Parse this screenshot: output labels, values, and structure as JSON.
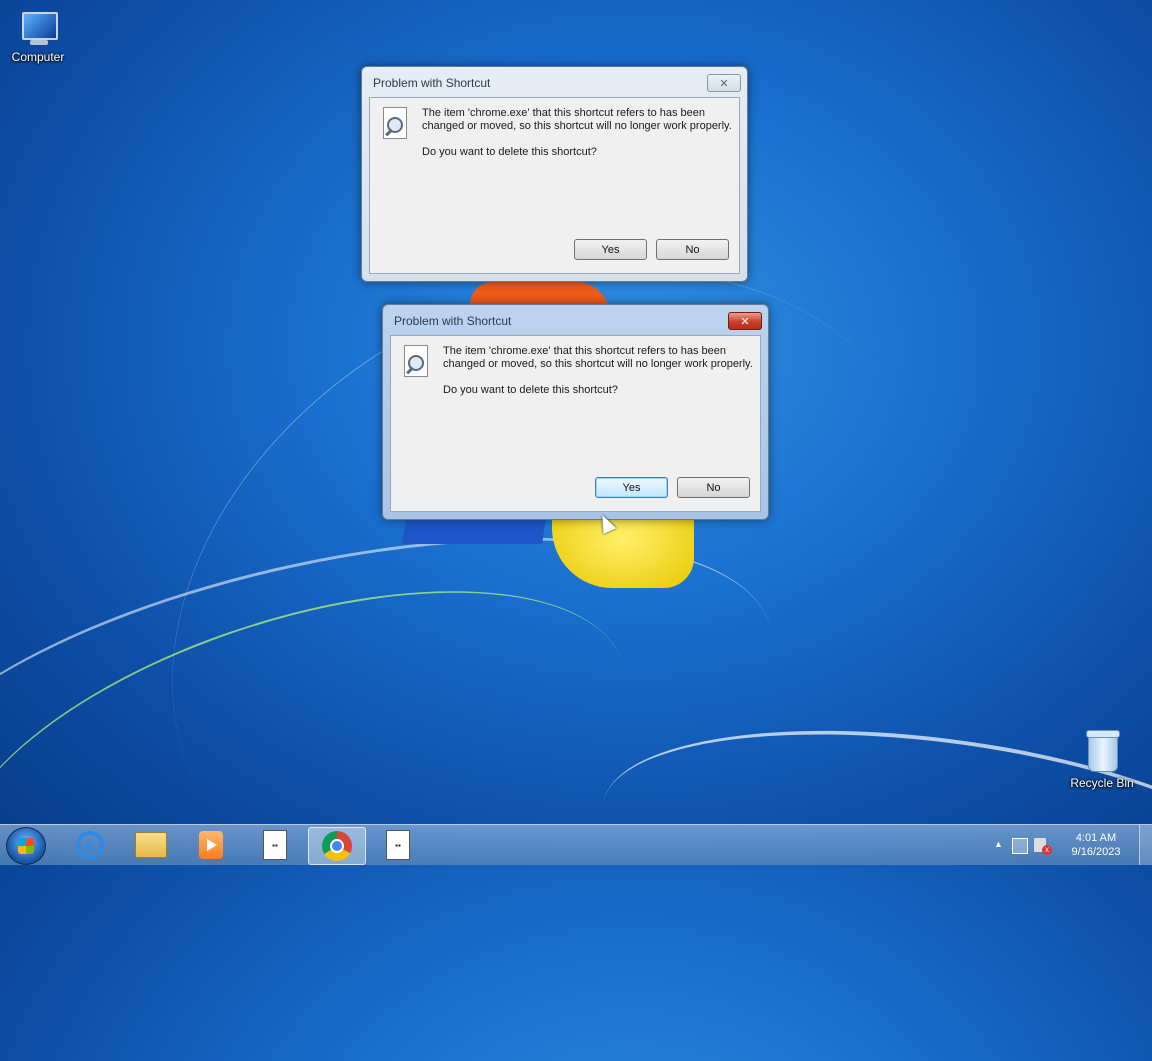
{
  "desktop": {
    "icons": [
      {
        "label": "Computer",
        "icon": "computer-icon"
      },
      {
        "label": "Recycle Bin",
        "icon": "recycle-bin-icon"
      }
    ]
  },
  "dialogs": [
    {
      "title": "Problem with Shortcut",
      "state": "inactive",
      "message_line1": "The item 'chrome.exe' that this shortcut refers to has been",
      "message_line2": "changed or moved, so this shortcut will no longer work properly.",
      "question": "Do you want to delete this shortcut?",
      "close_label": "✕",
      "yes_label": "Yes",
      "no_label": "No"
    },
    {
      "title": "Problem with Shortcut",
      "state": "active",
      "message_line1": "The item 'chrome.exe' that this shortcut refers to has been",
      "message_line2": "changed or moved, so this shortcut will no longer work properly.",
      "question": "Do you want to delete this shortcut?",
      "close_label": "✕",
      "yes_label": "Yes",
      "no_label": "No"
    }
  ],
  "taskbar": {
    "items": [
      {
        "icon": "start-icon"
      },
      {
        "icon": "internet-explorer-icon"
      },
      {
        "icon": "file-explorer-icon"
      },
      {
        "icon": "media-player-icon"
      },
      {
        "icon": "window-icon"
      },
      {
        "icon": "chrome-icon"
      },
      {
        "icon": "window-icon"
      }
    ],
    "tray": {
      "time": "4:01 AM",
      "date": "9/16/2023",
      "expand_label": "▲"
    },
    "ie_glyph": "e",
    "win_glyph": "▪▪"
  },
  "colors": {
    "desktop_bg": "#1a6fcf",
    "active_close": "#c7412b",
    "default_button_border": "#3c7fb1"
  }
}
